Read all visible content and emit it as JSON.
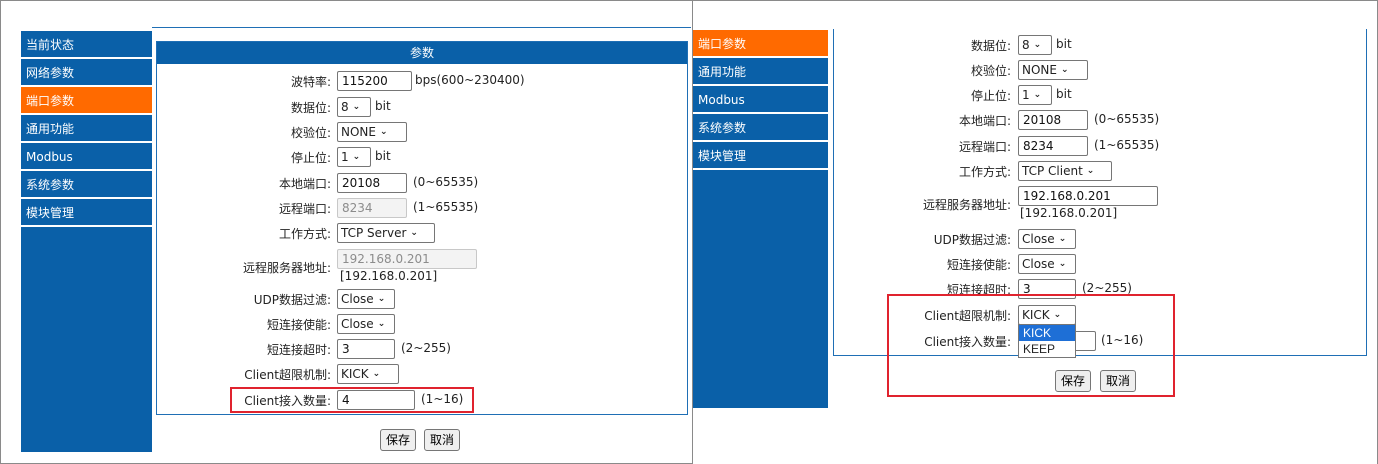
{
  "left": {
    "nav": [
      "当前状态",
      "网络参数",
      "端口参数",
      "通用功能",
      "Modbus",
      "系统参数",
      "模块管理"
    ],
    "panel_title": "参数",
    "baud": {
      "label": "波特率:",
      "value": "115200",
      "hint": "bps(600~230400)"
    },
    "databits": {
      "label": "数据位:",
      "value": "8",
      "unit": "bit"
    },
    "parity": {
      "label": "校验位:",
      "value": "NONE"
    },
    "stopbits": {
      "label": "停止位:",
      "value": "1",
      "unit": "bit"
    },
    "local_port": {
      "label": "本地端口:",
      "value": "20108",
      "hint": "(0~65535)"
    },
    "remote_port": {
      "label": "远程端口:",
      "value": "8234",
      "hint": "(1~65535)"
    },
    "work_mode": {
      "label": "工作方式:",
      "value": "TCP Server"
    },
    "server_addr": {
      "label": "远程服务器地址:",
      "value": "192.168.0.201",
      "sub": "[192.168.0.201]"
    },
    "udp_filter": {
      "label": "UDP数据过滤:",
      "value": "Close"
    },
    "short_conn": {
      "label": "短连接使能:",
      "value": "Close"
    },
    "short_timeout": {
      "label": "短连接超时:",
      "value": "3",
      "hint": "(2~255)"
    },
    "client_limit": {
      "label": "Client超限机制:",
      "value": "KICK"
    },
    "client_count": {
      "label": "Client接入数量:",
      "value": "4",
      "hint": "(1~16)"
    },
    "save": "保存",
    "cancel": "取消"
  },
  "right": {
    "nav": [
      "端口参数",
      "通用功能",
      "Modbus",
      "系统参数",
      "模块管理"
    ],
    "databits": {
      "label": "数据位:",
      "value": "8",
      "unit": "bit"
    },
    "parity": {
      "label": "校验位:",
      "value": "NONE"
    },
    "stopbits": {
      "label": "停止位:",
      "value": "1",
      "unit": "bit"
    },
    "local_port": {
      "label": "本地端口:",
      "value": "20108",
      "hint": "(0~65535)"
    },
    "remote_port": {
      "label": "远程端口:",
      "value": "8234",
      "hint": "(1~65535)"
    },
    "work_mode": {
      "label": "工作方式:",
      "value": "TCP Client"
    },
    "server_addr": {
      "label": "远程服务器地址:",
      "value": "192.168.0.201",
      "sub": "[192.168.0.201]"
    },
    "udp_filter": {
      "label": "UDP数据过滤:",
      "value": "Close"
    },
    "short_conn": {
      "label": "短连接使能:",
      "value": "Close"
    },
    "short_timeout": {
      "label": "短连接超时:",
      "value": "3",
      "hint": "(2~255)"
    },
    "client_limit": {
      "label": "Client超限机制:",
      "value": "KICK"
    },
    "client_count": {
      "label": "Client接入数量:",
      "hint": "(1~16)"
    },
    "dropdown_options": [
      "KICK",
      "KEEP"
    ],
    "save": "保存",
    "cancel": "取消"
  },
  "colors": {
    "nav_bg": "#0a60a8",
    "nav_active": "#ff6a00",
    "highlight_border": "#e0232e",
    "option_highlight": "#1e6fd6"
  }
}
